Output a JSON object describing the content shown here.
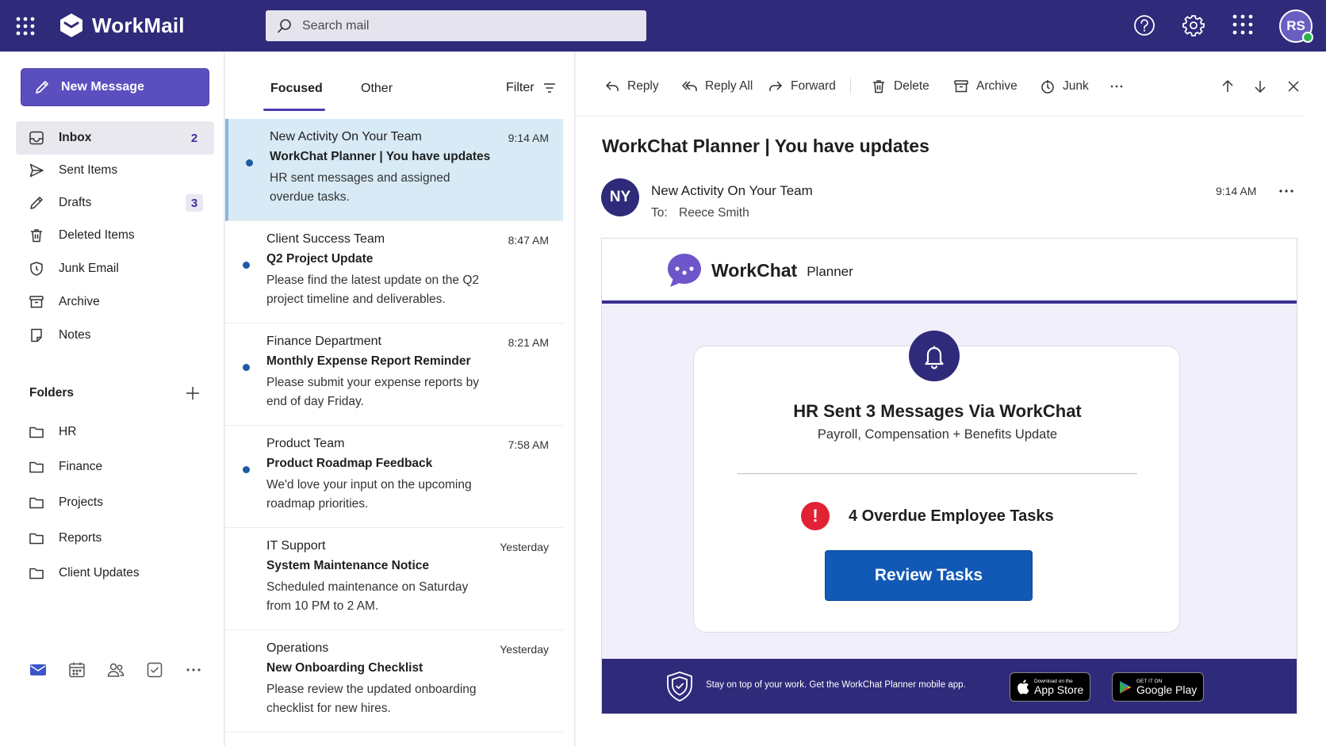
{
  "app": {
    "name": "WorkMail",
    "user_initials": "RS"
  },
  "search": {
    "placeholder": "Search mail"
  },
  "leftnav": {
    "new_message": "New Message",
    "items": [
      {
        "label": "Inbox",
        "count": "2"
      },
      {
        "label": "Sent Items",
        "count": ""
      },
      {
        "label": "Drafts",
        "count": "3"
      },
      {
        "label": "Deleted Items",
        "count": ""
      },
      {
        "label": "Junk Email",
        "count": ""
      },
      {
        "label": "Archive",
        "count": ""
      },
      {
        "label": "Notes",
        "count": ""
      }
    ],
    "folders_heading": "Folders",
    "folders": [
      "HR",
      "Finance",
      "Projects",
      "Reports",
      "Client Updates"
    ]
  },
  "list": {
    "tabs": [
      "Focused",
      "Other"
    ],
    "filter": "Filter",
    "messages": [
      {
        "sender": "New Activity On Your Team",
        "subject": "WorkChat Planner | You have updates",
        "preview": "HR sent messages and assigned overdue tasks.",
        "time": "9:14 AM"
      },
      {
        "sender": "Client Success Team",
        "subject": "Q2 Project Update",
        "preview": "Please find the latest update on the Q2 project timeline and deliverables.",
        "time": "8:47 AM"
      },
      {
        "sender": "Finance Department",
        "subject": "Monthly Expense Report Reminder",
        "preview": "Please submit your expense reports by end of day Friday.",
        "time": "8:21 AM"
      },
      {
        "sender": "Product Team",
        "subject": "Product Roadmap Feedback",
        "preview": "We'd love your input on the upcoming roadmap priorities.",
        "time": "7:58 AM"
      },
      {
        "sender": "IT Support",
        "subject": "System Maintenance Notice",
        "preview": "Scheduled maintenance on Saturday from 10 PM to 2 AM.",
        "time": "Yesterday"
      },
      {
        "sender": "Operations",
        "subject": "New Onboarding Checklist",
        "preview": "Please review the updated onboarding checklist for new hires.",
        "time": "Yesterday"
      }
    ]
  },
  "reader": {
    "commands": {
      "reply": "Reply",
      "reply_all": "Reply All",
      "forward": "Forward",
      "delete": "Delete",
      "archive": "Archive",
      "junk": "Junk"
    },
    "title": "WorkChat Planner | You have updates",
    "avatar": "NY",
    "sender": "New Activity On Your Team",
    "to_label": "To:",
    "to": "Reece Smith",
    "time": "9:14 AM"
  },
  "email": {
    "brand": "WorkChat",
    "brand_sub": "Planner",
    "card_title": "HR Sent 3 Messages Via WorkChat",
    "card_subtitle": "Payroll, Compensation + Benefits Update",
    "alert_icon": "!",
    "alert_text": "4 Overdue Employee Tasks",
    "button": "Review Tasks",
    "footer_text": "Stay on top of your work. Get the WorkChat Planner mobile app.",
    "app_store_small": "Download on the",
    "app_store": "App Store",
    "google_play_small": "GET IT ON",
    "google_play": "Google Play"
  },
  "colors": {
    "brand": "#2f2a7a",
    "accent": "#5b4fc0",
    "button": "#1258b5",
    "alert": "#e12134",
    "unread_dot": "#1f5aa6"
  },
  "icons": [
    "app-launcher-icon",
    "workmail-logo-icon",
    "search-icon",
    "help-icon",
    "settings-icon",
    "apps-icon",
    "pencil-icon",
    "inbox-icon",
    "send-icon",
    "drafts-icon",
    "trash-icon",
    "junk-icon",
    "archive-icon",
    "note-icon",
    "folder-icon",
    "plus-icon",
    "mail-icon",
    "calendar-icon",
    "people-icon",
    "tasks-icon",
    "more-icon",
    "filter-icon",
    "reply-icon",
    "reply-all-icon",
    "forward-icon",
    "junk-icon",
    "arrow-up-icon",
    "arrow-down-icon",
    "close-icon",
    "bell-icon",
    "shield-icon",
    "apple-icon",
    "play-icon"
  ]
}
